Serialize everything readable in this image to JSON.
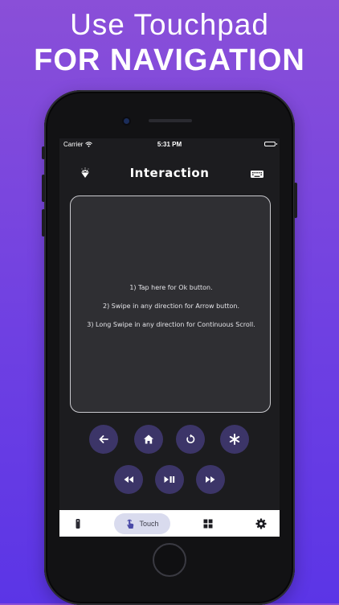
{
  "headline": {
    "line1": "Use Touchpad",
    "line2": "FOR NAVIGATION"
  },
  "status_bar": {
    "carrier": "Carrier",
    "time": "5:31 PM"
  },
  "app": {
    "title": "Interaction",
    "left_icon": "diamond-icon",
    "right_icon": "keyboard-icon"
  },
  "touchpad": {
    "instructions": [
      "1) Tap here for Ok button.",
      "2) Swipe in any direction for Arrow button.",
      "3) Long Swipe in any direction for Continuous Scroll."
    ]
  },
  "controls": {
    "row1": [
      "back-arrow-icon",
      "home-icon",
      "replay-icon",
      "asterisk-icon"
    ],
    "row2": [
      "rewind-icon",
      "play-pause-icon",
      "fast-forward-icon"
    ]
  },
  "tab_bar": {
    "tabs": [
      {
        "icon": "remote-icon",
        "label": ""
      },
      {
        "icon": "touch-icon",
        "label": "Touch",
        "active": true
      },
      {
        "icon": "grid-icon",
        "label": ""
      },
      {
        "icon": "gear-icon",
        "label": ""
      }
    ]
  },
  "colors": {
    "background_top": "#8a4fd8",
    "background_bottom": "#5b35e6",
    "screen_bg": "#1c1c1f",
    "touchpad_bg": "#2f2f33",
    "control_button": "#3c3568",
    "active_tab": "#d9dbee"
  }
}
